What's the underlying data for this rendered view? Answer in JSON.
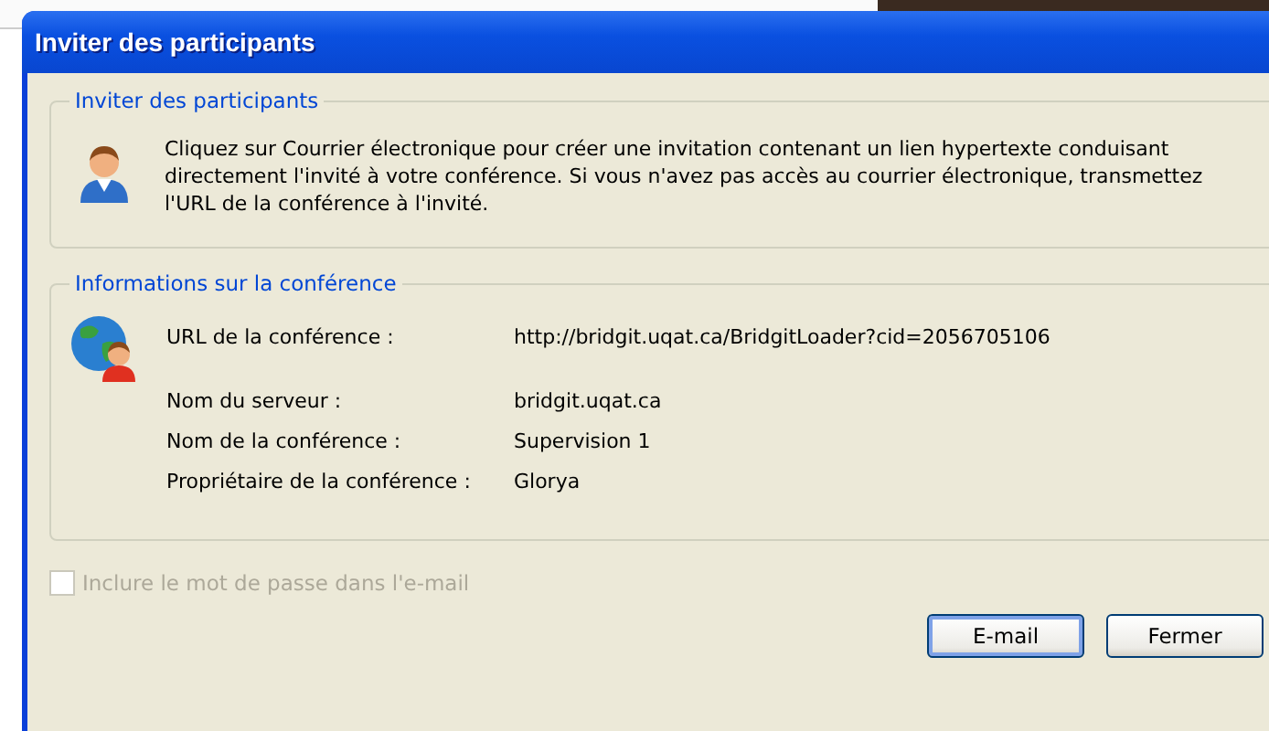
{
  "window": {
    "title": "Inviter des participants"
  },
  "invite_group": {
    "title": "Inviter des participants",
    "text": "Cliquez sur Courrier électronique pour créer une invitation contenant un lien hypertexte conduisant directement l'invité à votre conférence. Si vous n'avez pas accès au courrier électronique, transmettez l'URL de la conférence à l'invité."
  },
  "info_group": {
    "title": "Informations sur la conférence",
    "fields": [
      {
        "label": "URL de la conférence :",
        "value": "http://bridgit.uqat.ca/BridgitLoader?cid=2056705106"
      },
      {
        "label": "Nom du serveur :",
        "value": "bridgit.uqat.ca"
      },
      {
        "label": "Nom de la conférence :",
        "value": "Supervision 1"
      },
      {
        "label": "Propriétaire de la conférence :",
        "value": "Glorya"
      }
    ]
  },
  "password_checkbox": {
    "label": "Inclure le mot de passe dans l'e-mail",
    "checked": false,
    "disabled": true
  },
  "buttons": [
    {
      "label": "E-mail",
      "default": true
    },
    {
      "label": "Fermer",
      "default": false
    }
  ]
}
